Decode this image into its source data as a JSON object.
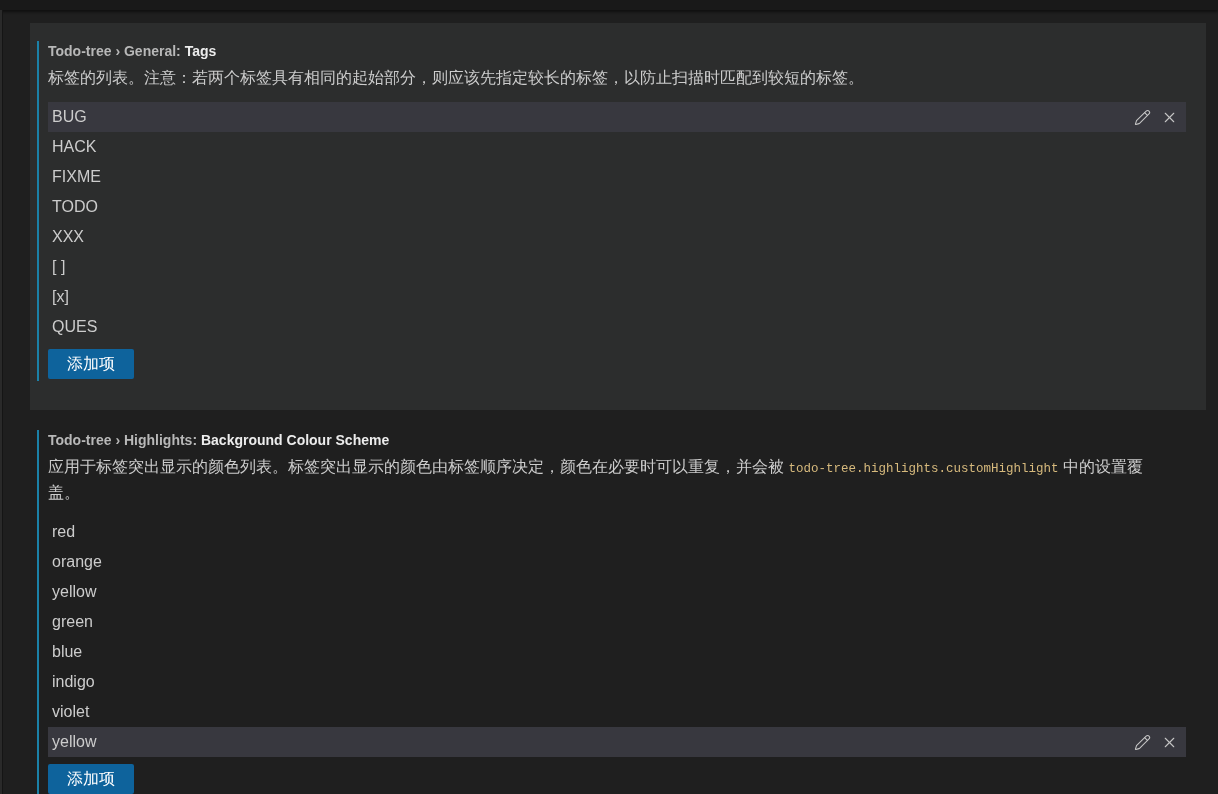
{
  "settings": [
    {
      "focused": true,
      "title": "Todo-tree › General: **Tags**",
      "description": [
        {
          "kind": "text",
          "text": "标签的列表。注意：若两个标签具有相同的起始部分，则应该先指定较长的标签，以防止扫描时匹配到较短的标签。"
        }
      ],
      "items": [
        {
          "value": "BUG",
          "selected": true
        },
        {
          "value": "HACK",
          "selected": false
        },
        {
          "value": "FIXME",
          "selected": false
        },
        {
          "value": "TODO",
          "selected": false
        },
        {
          "value": "XXX",
          "selected": false
        },
        {
          "value": "[ ]",
          "selected": false
        },
        {
          "value": "[x]",
          "selected": false
        },
        {
          "value": "QUES",
          "selected": false
        }
      ],
      "add_button": "添加项"
    },
    {
      "focused": false,
      "title": "Todo-tree › Highlights: **Background Colour Scheme**",
      "description": [
        {
          "kind": "text",
          "text": "应用于标签突出显示的颜色列表。标签突出显示的颜色由标签顺序决定，颜色在必要时可以重复，并会被"
        },
        {
          "kind": "code",
          "text": "todo-tree.highlights.customHighlight"
        },
        {
          "kind": "text",
          "text": "中的设置覆盖。"
        }
      ],
      "items": [
        {
          "value": "red",
          "selected": false
        },
        {
          "value": "orange",
          "selected": false
        },
        {
          "value": "yellow",
          "selected": false
        },
        {
          "value": "green",
          "selected": false
        },
        {
          "value": "blue",
          "selected": false
        },
        {
          "value": "indigo",
          "selected": false
        },
        {
          "value": "violet",
          "selected": false
        },
        {
          "value": "yellow",
          "selected": true
        }
      ],
      "add_button": "添加项"
    }
  ]
}
